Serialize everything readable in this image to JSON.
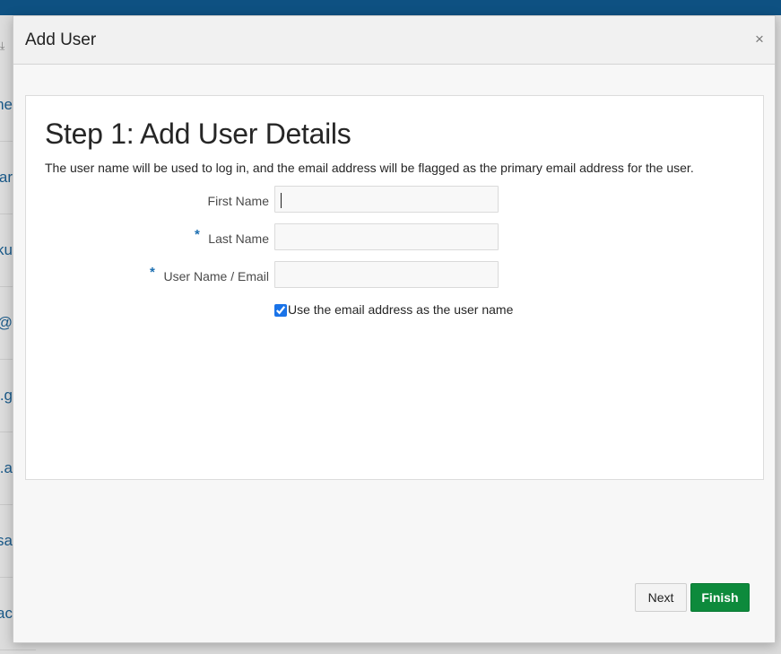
{
  "background": {
    "rows": [
      "ne",
      "ar",
      "ku",
      "k@",
      "g.g",
      "l.a",
      "sa",
      "ac"
    ]
  },
  "dialog": {
    "title": "Add User",
    "close_symbol": "×"
  },
  "step": {
    "title": "Step 1: Add User Details",
    "description": "The user name will be used to log in, and the email address will be flagged as the primary email address for the user."
  },
  "form": {
    "first_name_label": "First Name",
    "first_name_value": "",
    "last_name_label": "Last Name",
    "last_name_value": "",
    "username_label": "User Name / Email",
    "username_value": "",
    "required_marker": "*",
    "use_email_label": "Use the email address as the user name",
    "use_email_checked": true
  },
  "buttons": {
    "next_label": "Next",
    "finish_label": "Finish"
  },
  "colors": {
    "finish": "#0d8a3c",
    "required": "#1d6fb1",
    "topbar": "#0e5182"
  }
}
